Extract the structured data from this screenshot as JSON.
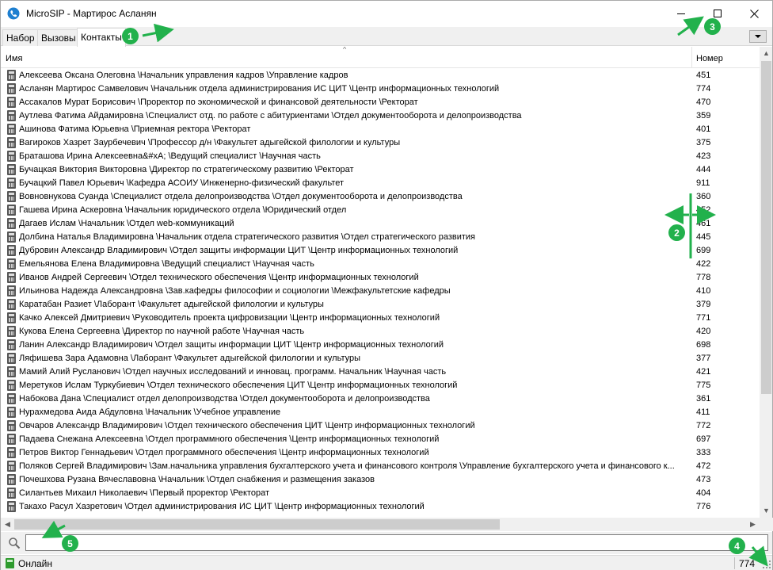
{
  "window": {
    "title": "MicroSIP - Мартирос Асланян",
    "minimize_icon": "minimize-icon",
    "maximize_icon": "maximize-icon",
    "close_icon": "close-icon"
  },
  "tabs": [
    {
      "label": "Набор"
    },
    {
      "label": "Вызовы"
    },
    {
      "label": "Контакты",
      "active": true
    }
  ],
  "tab_menu_icon": "dropdown-triangle-icon",
  "columns": {
    "name": "Имя",
    "number": "Номер"
  },
  "contacts": [
    {
      "name": "Алексеева Оксана Олеговна \\Начальник управления кадров \\Управление кадров",
      "number": "451"
    },
    {
      "name": "Асланян Мартирос Самвелович \\Начальник отдела администрирования ИС ЦИТ \\Центр информационных технологий",
      "number": "774"
    },
    {
      "name": "Ассакалов Мурат Борисович \\Проректор по экономической и финансовой деятельности \\Ректорат",
      "number": "470"
    },
    {
      "name": "Аутлева Фатима Айдамировна \\Специалист отд. по работе с абитуриентами \\Отдел документооборота и делопроизводства",
      "number": "359"
    },
    {
      "name": "Ашинова Фатима Юрьевна \\Приемная ректора \\Ректорат",
      "number": "401"
    },
    {
      "name": "Вагироков Хазрет Заурбечевич \\Профессор д/н \\Факультет адыгейской филологии и культуры",
      "number": "375"
    },
    {
      "name": "Браташова Ирина Алексеевна&#xA; \\Ведущий специалист \\Научная часть",
      "number": "423"
    },
    {
      "name": "Бучацкая Виктория Викторовна \\Директор по стратегическому развитию \\Ректорат",
      "number": "444"
    },
    {
      "name": "Бучацкий Павел Юрьевич \\Кафедра АСОИУ \\Инженерно-физический факультет",
      "number": "911"
    },
    {
      "name": "Вовновнукова Суанда \\Специалист отдела делопроизводства \\Отдел документооборота и делопроизводства",
      "number": "360"
    },
    {
      "name": "Гашева Ирина Аскеровна \\Начальник юридического отдела \\Юридический отдел",
      "number": "452"
    },
    {
      "name": "Дагаев Ислам \\Начальник \\Отдел web-коммуникаций",
      "number": "461"
    },
    {
      "name": "Долбина Наталья Владимировна \\Начальник отдела стратегического развития \\Отдел стратегического развития",
      "number": "445"
    },
    {
      "name": "Дубровин Александр Владимирович \\Отдел защиты информации ЦИТ \\Центр информационных технологий",
      "number": "699"
    },
    {
      "name": "Емельянова Елена Владимировна \\Ведущий специалист \\Научная часть",
      "number": "422"
    },
    {
      "name": "Иванов Андрей Сергеевич \\Отдел технического обеспечения \\Центр информационных технологий",
      "number": "778"
    },
    {
      "name": "Ильинова Надежда Александровна \\Зав.кафедры философии и социологии \\Межфакультетские кафедры",
      "number": "410"
    },
    {
      "name": "Каратабан Разиет \\Лаборант \\Факультет адыгейской филологии и культуры",
      "number": "379"
    },
    {
      "name": "Качко Алексей Дмитриевич \\Руководитель проекта цифровизации \\Центр информационных технологий",
      "number": "771"
    },
    {
      "name": "Кукова Елена Сергеевна \\Директор по научной работе \\Научная часть",
      "number": "420"
    },
    {
      "name": "Ланин Александр Владимирович \\Отдел защиты информации ЦИТ \\Центр информационных технологий",
      "number": "698"
    },
    {
      "name": "Ляфишева Зара Адамовна \\Лаборант \\Факультет адыгейской филологии и культуры",
      "number": "377"
    },
    {
      "name": "Мамий Алий Русланович \\Отдел научных исследований и инновац. программ. Начальник \\Научная часть",
      "number": "421"
    },
    {
      "name": "Меретуков Ислам Туркубиевич \\Отдел технического обеспечения ЦИТ \\Центр информационных технологий",
      "number": "775"
    },
    {
      "name": "Набокова Дана \\Специалист отдел делопроизводства \\Отдел документооборота и делопроизводства",
      "number": "361"
    },
    {
      "name": "Нурахмедова Аида Абдуловна \\Начальник \\Учебное управление",
      "number": "411"
    },
    {
      "name": "Овчаров Александр Владимирович \\Отдел технического обеспечения ЦИТ \\Центр информационных технологий",
      "number": "772"
    },
    {
      "name": "Падаева Снежана Алексеевна \\Отдел программного обеспечения \\Центр информационных технологий",
      "number": "697"
    },
    {
      "name": "Петров Виктор Геннадьевич \\Отдел программного обеспечения \\Центр информационных технологий",
      "number": "333"
    },
    {
      "name": "Поляков Сергей Владимирович \\Зам.начальника управления бухгалтерского учета и финансового контроля \\Управление бухгалтерского учета и финансового к...",
      "number": "472"
    },
    {
      "name": "Почешхова Рузана Вячеславовна \\Начальник \\Отдел снабжения и размещения заказов",
      "number": "473"
    },
    {
      "name": "Силантьев Михаил Николаевич \\Первый проректор \\Ректорат",
      "number": "404"
    },
    {
      "name": "Такахо Расул Хазретович \\Отдел администрирования ИС ЦИТ \\Центр информационных технологий",
      "number": "776"
    }
  ],
  "search": {
    "value": "",
    "placeholder": "",
    "icon": "search-icon"
  },
  "status": {
    "text": "Онлайн",
    "extension": "774",
    "icon": "online-status-icon"
  },
  "colors": {
    "annotation": "#22b14c",
    "status_online": "#2e9b2e"
  },
  "annotations": [
    {
      "label": "1"
    },
    {
      "label": "2"
    },
    {
      "label": "3"
    },
    {
      "label": "4"
    },
    {
      "label": "5"
    }
  ]
}
